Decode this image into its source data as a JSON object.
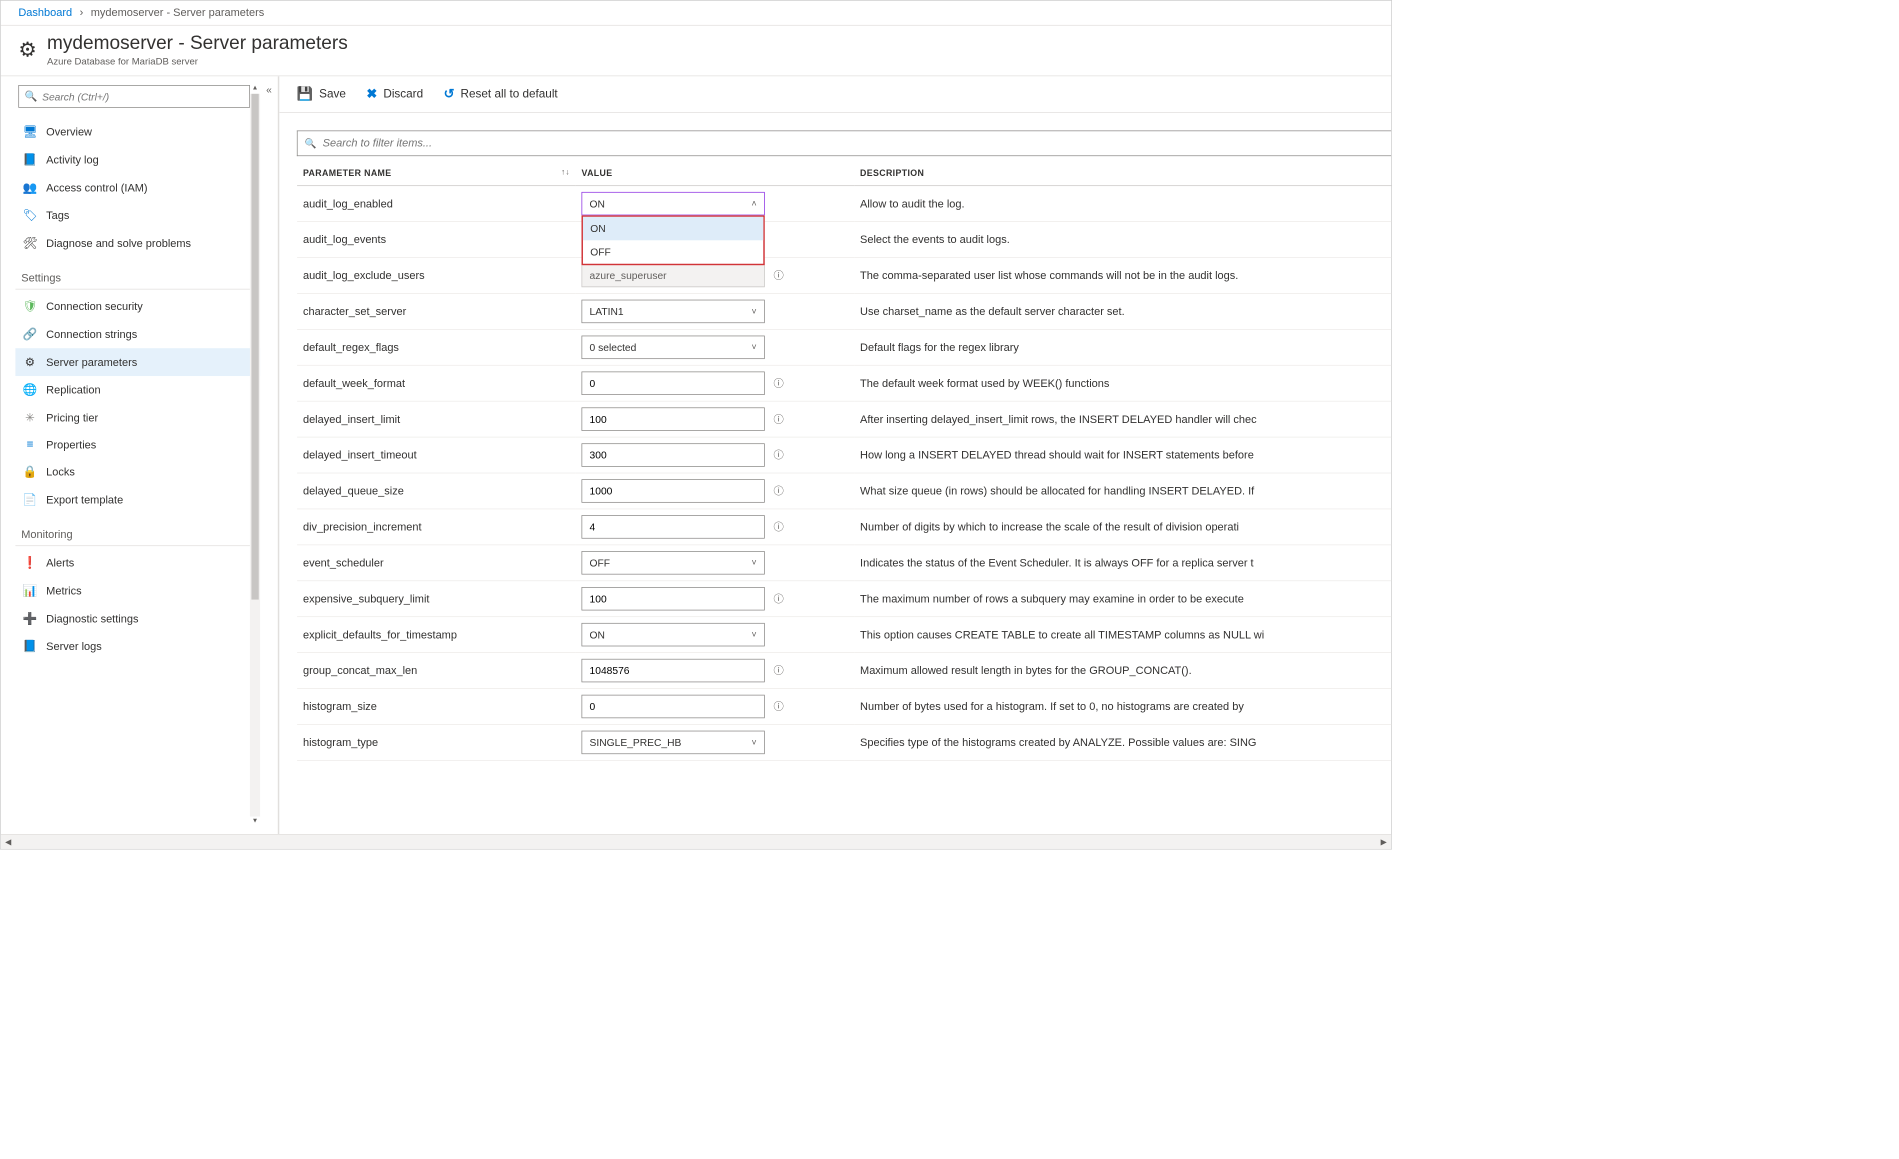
{
  "breadcrumb": {
    "root": "Dashboard",
    "current": "mydemoserver - Server parameters"
  },
  "header": {
    "title": "mydemoserver - Server parameters",
    "sub": "Azure Database for MariaDB server"
  },
  "sidebar": {
    "search_placeholder": "Search (Ctrl+/)",
    "top": [
      {
        "icon": "🖥",
        "color": "#0078d4",
        "label": "Overview"
      },
      {
        "icon": "📘",
        "color": "#0078d4",
        "label": "Activity log"
      },
      {
        "icon": "👥",
        "color": "#0078d4",
        "label": "Access control (IAM)"
      },
      {
        "icon": "🏷",
        "color": "#0078d4",
        "label": "Tags"
      },
      {
        "icon": "🛠",
        "color": "#323130",
        "label": "Diagnose and solve problems"
      }
    ],
    "section_settings": "Settings",
    "settings": [
      {
        "icon": "🛡",
        "color": "#5cb85c",
        "label": "Connection security"
      },
      {
        "icon": "🔗",
        "color": "#605e5c",
        "label": "Connection strings"
      },
      {
        "icon": "⚙",
        "color": "#323130",
        "label": "Server parameters",
        "selected": true
      },
      {
        "icon": "🌐",
        "color": "#0078d4",
        "label": "Replication"
      },
      {
        "icon": "✳",
        "color": "#8a8886",
        "label": "Pricing tier"
      },
      {
        "icon": "≡",
        "color": "#0078d4",
        "label": "Properties"
      },
      {
        "icon": "🔒",
        "color": "#323130",
        "label": "Locks"
      },
      {
        "icon": "📄",
        "color": "#0078d4",
        "label": "Export template"
      }
    ],
    "section_monitoring": "Monitoring",
    "monitoring": [
      {
        "icon": "❗",
        "color": "#8bc34a",
        "label": "Alerts"
      },
      {
        "icon": "📊",
        "color": "#0078d4",
        "label": "Metrics"
      },
      {
        "icon": "➕",
        "color": "#5cb85c",
        "label": "Diagnostic settings"
      },
      {
        "icon": "📘",
        "color": "#0078d4",
        "label": "Server logs"
      }
    ]
  },
  "toolbar": {
    "save": "Save",
    "discard": "Discard",
    "reset": "Reset all to default"
  },
  "filter_placeholder": "Search to filter items...",
  "columns": {
    "name": "PARAMETER NAME",
    "value": "VALUE",
    "desc": "DESCRIPTION"
  },
  "dropdown": {
    "options": [
      "ON",
      "OFF"
    ],
    "selected": "ON"
  },
  "rows": [
    {
      "name": "audit_log_enabled",
      "type": "select_open",
      "value": "ON",
      "desc": "Allow to audit the log."
    },
    {
      "name": "audit_log_events",
      "type": "hidden_by_dropdown",
      "value": "",
      "desc": "Select the events to audit logs."
    },
    {
      "name": "audit_log_exclude_users",
      "type": "readonly",
      "value": "azure_superuser",
      "info": true,
      "desc": "The comma-separated user list whose commands will not be in the audit logs."
    },
    {
      "name": "character_set_server",
      "type": "select",
      "value": "LATIN1",
      "desc": "Use charset_name as the default server character set."
    },
    {
      "name": "default_regex_flags",
      "type": "select",
      "value": "0 selected",
      "desc": "Default flags for the regex library"
    },
    {
      "name": "default_week_format",
      "type": "text",
      "value": "0",
      "info": true,
      "desc": "The default week format used by WEEK() functions"
    },
    {
      "name": "delayed_insert_limit",
      "type": "text",
      "value": "100",
      "info": true,
      "desc": "After inserting delayed_insert_limit rows, the INSERT DELAYED handler will chec"
    },
    {
      "name": "delayed_insert_timeout",
      "type": "text",
      "value": "300",
      "info": true,
      "desc": "How long a INSERT DELAYED thread should wait for INSERT statements before "
    },
    {
      "name": "delayed_queue_size",
      "type": "text",
      "value": "1000",
      "info": true,
      "desc": "What size queue (in rows) should be allocated for handling INSERT DELAYED. If"
    },
    {
      "name": "div_precision_increment",
      "type": "text",
      "value": "4",
      "info": true,
      "desc": "Number of digits by which to increase the scale of the result of division operati"
    },
    {
      "name": "event_scheduler",
      "type": "select",
      "value": "OFF",
      "desc": "Indicates the status of the Event Scheduler. It is always OFF for a replica server t"
    },
    {
      "name": "expensive_subquery_limit",
      "type": "text",
      "value": "100",
      "info": true,
      "desc": "The maximum number of rows a subquery may examine in order to be execute"
    },
    {
      "name": "explicit_defaults_for_timestamp",
      "type": "select",
      "value": "ON",
      "desc": "This option causes CREATE TABLE to create all TIMESTAMP columns as NULL wi"
    },
    {
      "name": "group_concat_max_len",
      "type": "text",
      "value": "1048576",
      "info": true,
      "desc": "Maximum allowed result length in bytes for the GROUP_CONCAT()."
    },
    {
      "name": "histogram_size",
      "type": "text",
      "value": "0",
      "info": true,
      "desc": "Number of bytes used for a histogram. If set to 0, no histograms are created by"
    },
    {
      "name": "histogram_type",
      "type": "select",
      "value": "SINGLE_PREC_HB",
      "desc": "Specifies type of the histograms created by ANALYZE. Possible values are: SING"
    }
  ]
}
